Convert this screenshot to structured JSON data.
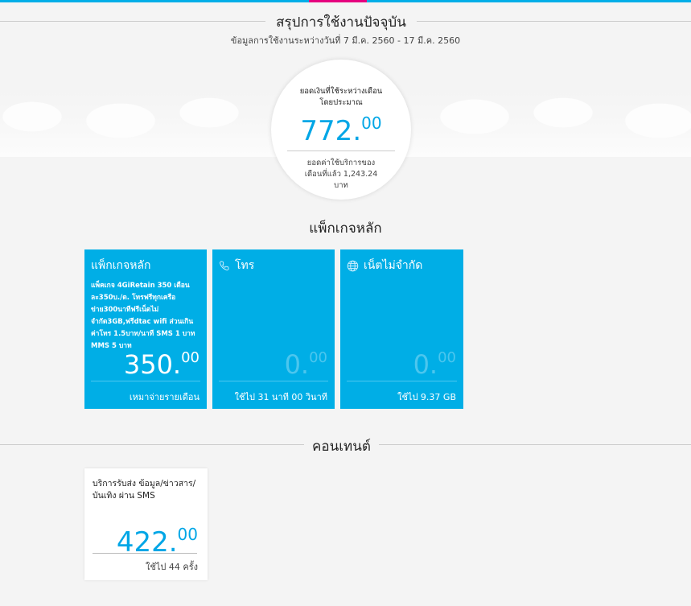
{
  "header": {
    "title": "สรุปการใช้งานปัจจุบัน",
    "subtitle": "ข้อมูลการใช้งานระหว่างวันที่ 7 มี.ค. 2560 - 17 มี.ค. 2560"
  },
  "summary": {
    "label": "ยอดเงินที่ใช้ระหว่างเดือน โดยประมาณ",
    "amount": "772.",
    "decimals": "00",
    "prev_label": "ยอดค่าใช้บริการของ",
    "prev_value": "เดือนที่แล้ว 1,243.24",
    "prev_unit": "บาท"
  },
  "packages": {
    "title": "แพ็กเกจหลัก",
    "cards": [
      {
        "title": "แพ็กเกจหลัก",
        "desc": "แพ็คเกจ 4GiRetain 350 เดือนละ350บ./ด. โทรฟรีทุกเครือข่าย300นาทีฟรีเน็ตไม่จำกัด3GB,ฟรีdtac wifi ส่วนเกินค่าโทร 1.5บาท/นาที SMS 1 บาท MMS 5 บาท",
        "amount": "350.",
        "decimals": "00",
        "footer": "เหมาจ่ายรายเดือน",
        "icon": null
      },
      {
        "title": "โทร",
        "amount": "0.",
        "decimals": "00",
        "footer": "ใช้ไป 31 นาที 00 วินาที",
        "icon": "phone-icon"
      },
      {
        "title": "เน็ตไม่จำกัด",
        "amount": "0.",
        "decimals": "00",
        "footer": "ใช้ไป 9.37 GB",
        "icon": "globe-icon"
      }
    ]
  },
  "content": {
    "title": "คอนเทนต์",
    "cards": [
      {
        "title": "บริการรับส่ง ข้อมูล/ข่าวสาร/บันเทิง ผ่าน SMS",
        "amount": "422.",
        "decimals": "00",
        "footer": "ใช้ไป 44 ครั้ง"
      }
    ]
  },
  "colors": {
    "accent": "#00aee6",
    "pink": "#e6007e"
  }
}
